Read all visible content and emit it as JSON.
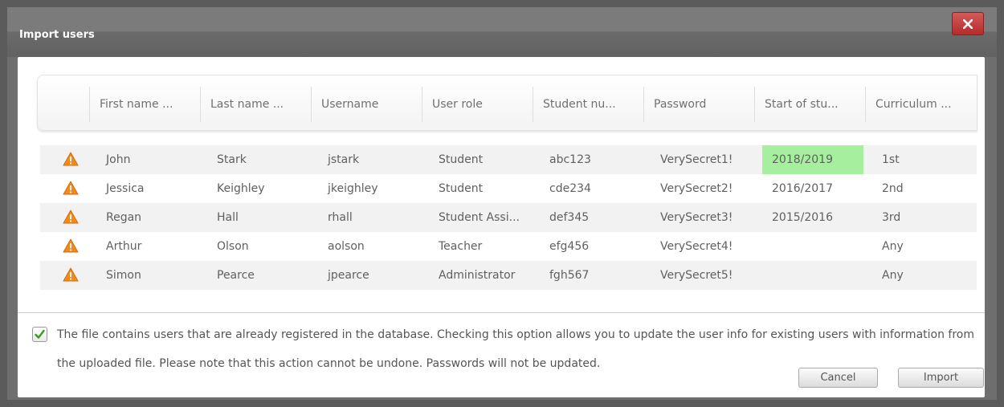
{
  "dialog": {
    "title": "Import users",
    "close_glyph": "×",
    "close_icon": "close-icon"
  },
  "table": {
    "columns": [
      "First name ...",
      "Last name ...",
      "Username",
      "User role",
      "Student nu...",
      "Password",
      "Start of stu...",
      "Curriculum ..."
    ],
    "rows": [
      {
        "status_icon": "warning-icon",
        "first_name": "John",
        "last_name": "Stark",
        "username": "jstark",
        "role": "Student",
        "student_number": "abc123",
        "password": "VerySecret1!",
        "start": "2018/2019",
        "curriculum": "1st",
        "start_highlighted": true
      },
      {
        "status_icon": "warning-icon",
        "first_name": "Jessica",
        "last_name": "Keighley",
        "username": "jkeighley",
        "role": "Student",
        "student_number": "cde234",
        "password": "VerySecret2!",
        "start": "2016/2017",
        "curriculum": "2nd"
      },
      {
        "status_icon": "warning-icon",
        "first_name": "Regan",
        "last_name": "Hall",
        "username": "rhall",
        "role": "Student Assi...",
        "student_number": "def345",
        "password": "VerySecret3!",
        "start": "2015/2016",
        "curriculum": "3rd"
      },
      {
        "status_icon": "warning-icon",
        "first_name": "Arthur",
        "last_name": "Olson",
        "username": "aolson",
        "role": "Teacher",
        "student_number": "efg456",
        "password": "VerySecret4!",
        "start": "",
        "curriculum": "Any"
      },
      {
        "status_icon": "warning-icon",
        "first_name": "Simon",
        "last_name": "Pearce",
        "username": "jpearce",
        "role": "Administrator",
        "student_number": "fgh567",
        "password": "VerySecret5!",
        "start": "",
        "curriculum": "Any"
      }
    ]
  },
  "update_option": {
    "checked": true,
    "text": "The file contains users that are already registered in the database. Checking this option allows you to update the user info for existing users with information from the uploaded file. Please note that this action cannot be undone. Passwords will not be updated."
  },
  "buttons": {
    "cancel": "Cancel",
    "import": "Import"
  },
  "colors": {
    "highlight": "#a6ef9e",
    "close_button": "#c13a3a",
    "warning": "#f08a1a"
  }
}
